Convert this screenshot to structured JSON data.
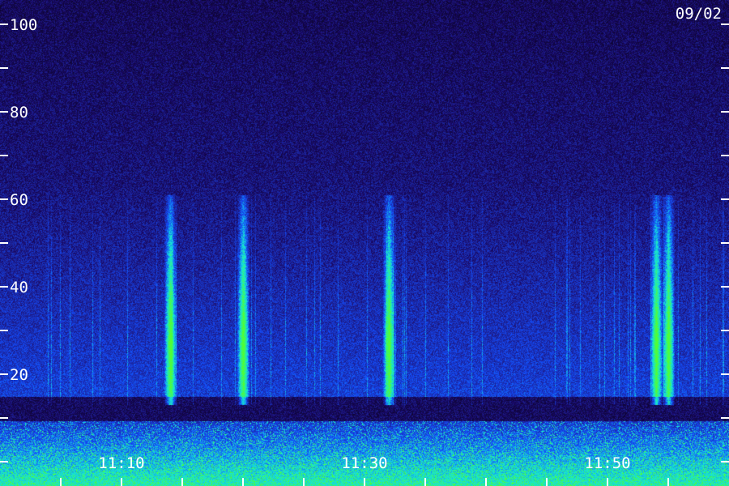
{
  "chart_data": {
    "type": "heatmap",
    "date_label": "09/02",
    "y_ticks": [
      0,
      10,
      20,
      30,
      40,
      50,
      60,
      70,
      80,
      90,
      100
    ],
    "y_tick_labels": [
      {
        "value": 20,
        "text": "20"
      },
      {
        "value": 40,
        "text": "40"
      },
      {
        "value": 60,
        "text": "60"
      },
      {
        "value": 80,
        "text": "80"
      },
      {
        "value": 100,
        "text": "100"
      }
    ],
    "ylim": [
      0,
      100
    ],
    "x_range_minutes": [
      1140,
      1200
    ],
    "x_tick_labels": [
      {
        "minute": 1150,
        "text": "11:10"
      },
      {
        "minute": 1170,
        "text": "11:30"
      },
      {
        "minute": 1190,
        "text": "11:50"
      }
    ],
    "x_major_ticks_minutes": [
      1145,
      1150,
      1155,
      1160,
      1165,
      1170,
      1175,
      1180,
      1185,
      1190,
      1195
    ],
    "colors": {
      "background": "#0a0418",
      "low": "#1e1070",
      "mid": "#2a40e0",
      "high": "#20e0e0",
      "peak": "#40ff40",
      "text": "#ffffff"
    },
    "grid": false,
    "bright_streaks_minutes": [
      1154,
      1160,
      1172,
      1194,
      1195
    ]
  }
}
